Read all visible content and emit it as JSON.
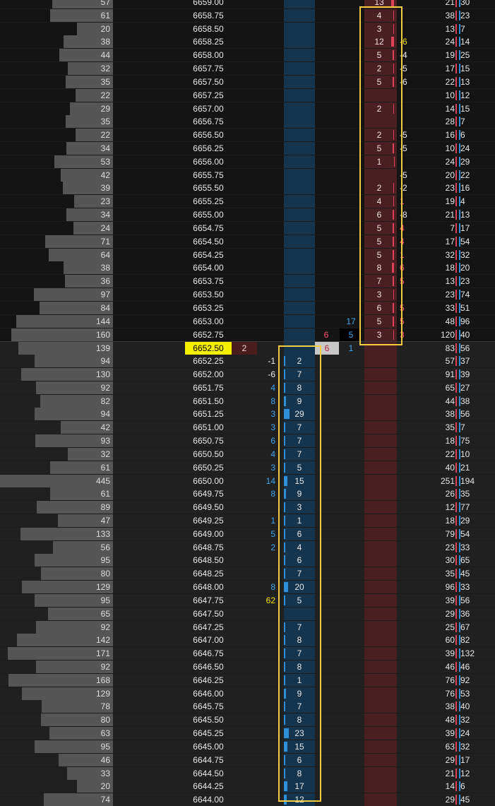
{
  "app_title": "",
  "last_price": "6652.50",
  "last_trade_size": "2",
  "colors": {
    "ask_bg": "#4a1f22",
    "bid_bg": "#15354e",
    "highlight": "#f3cc3f",
    "last_price_bg": "#f4ee00"
  },
  "ask_rows": [
    {
      "price": "6659.00",
      "volume": "57",
      "ask": "13",
      "ask_chg": "",
      "col1": "21",
      "col2": "30"
    },
    {
      "price": "6658.75",
      "volume": "61",
      "ask": "4",
      "ask_chg": "",
      "col1": "38",
      "col2": "23"
    },
    {
      "price": "6658.50",
      "volume": "20",
      "ask": "3",
      "ask_chg": "",
      "col1": "13",
      "col2": "7"
    },
    {
      "price": "6658.25",
      "volume": "38",
      "ask": "12",
      "ask_chg": "-6",
      "col1": "24",
      "col2": "14"
    },
    {
      "price": "6658.00",
      "volume": "44",
      "ask": "5",
      "ask_chg": "-4",
      "col1": "19",
      "col2": "25"
    },
    {
      "price": "6657.75",
      "volume": "32",
      "ask": "2",
      "ask_chg": "-5",
      "col1": "17",
      "col2": "15"
    },
    {
      "price": "6657.50",
      "volume": "35",
      "ask": "5",
      "ask_chg": "-6",
      "col1": "22",
      "col2": "13"
    },
    {
      "price": "6657.25",
      "volume": "22",
      "ask": "",
      "ask_chg": "",
      "col1": "10",
      "col2": "12"
    },
    {
      "price": "6657.00",
      "volume": "29",
      "ask": "2",
      "ask_chg": "",
      "col1": "14",
      "col2": "15"
    },
    {
      "price": "6656.75",
      "volume": "35",
      "ask": "",
      "ask_chg": "",
      "col1": "28",
      "col2": "7"
    },
    {
      "price": "6656.50",
      "volume": "22",
      "ask": "2",
      "ask_chg": "-5",
      "col1": "16",
      "col2": "6"
    },
    {
      "price": "6656.25",
      "volume": "34",
      "ask": "5",
      "ask_chg": "-5",
      "col1": "10",
      "col2": "24"
    },
    {
      "price": "6656.00",
      "volume": "53",
      "ask": "1",
      "ask_chg": "",
      "col1": "24",
      "col2": "29"
    },
    {
      "price": "6655.75",
      "volume": "42",
      "ask": "",
      "ask_chg": "-5",
      "col1": "20",
      "col2": "22"
    },
    {
      "price": "6655.50",
      "volume": "39",
      "ask": "2",
      "ask_chg": "-2",
      "col1": "23",
      "col2": "16"
    },
    {
      "price": "6655.25",
      "volume": "23",
      "ask": "4",
      "ask_chg": "1",
      "col1": "19",
      "col2": "4"
    },
    {
      "price": "6655.00",
      "volume": "34",
      "ask": "6",
      "ask_chg": "-8",
      "col1": "21",
      "col2": "13"
    },
    {
      "price": "6654.75",
      "volume": "24",
      "ask": "5",
      "ask_chg": "4",
      "col1": "7",
      "col2": "17"
    },
    {
      "price": "6654.50",
      "volume": "71",
      "ask": "5",
      "ask_chg": "4",
      "col1": "17",
      "col2": "54"
    },
    {
      "price": "6654.25",
      "volume": "64",
      "ask": "5",
      "ask_chg": "1",
      "col1": "32",
      "col2": "32"
    },
    {
      "price": "6654.00",
      "volume": "38",
      "ask": "8",
      "ask_chg": "6",
      "col1": "18",
      "col2": "20"
    },
    {
      "price": "6653.75",
      "volume": "36",
      "ask": "7",
      "ask_chg": "5",
      "col1": "13",
      "col2": "23"
    },
    {
      "price": "6653.50",
      "volume": "97",
      "ask": "3",
      "ask_chg": "",
      "col1": "23",
      "col2": "74"
    },
    {
      "price": "6653.25",
      "volume": "84",
      "ask": "6",
      "ask_chg": "5",
      "col1": "33",
      "col2": "51"
    },
    {
      "price": "6653.00",
      "volume": "144",
      "ask": "5",
      "ask_chg": "5",
      "col1": "48",
      "col2": "96"
    },
    {
      "price": "6652.75",
      "volume": "160",
      "ask": "3",
      "ask_chg": "3",
      "col1": "120",
      "col2": "40"
    }
  ],
  "row_6653_pulls": {
    "left": "17",
    "right": ""
  },
  "row_665275_pulls": {
    "a": "6",
    "b": "5"
  },
  "last_row": {
    "price": "6652.50",
    "volume": "139",
    "box": "6",
    "pull": "1",
    "col1": "83",
    "col2": "56"
  },
  "bid_rows": [
    {
      "price": "6652.25",
      "volume": "94",
      "bid_chg": "-1",
      "bid": "2",
      "col1": "57",
      "col2": "37"
    },
    {
      "price": "6652.00",
      "volume": "130",
      "bid_chg": "-6",
      "bid": "7",
      "col1": "91",
      "col2": "39"
    },
    {
      "price": "6651.75",
      "volume": "92",
      "bid_chg": "4",
      "bid": "8",
      "col1": "65",
      "col2": "27"
    },
    {
      "price": "6651.50",
      "volume": "82",
      "bid_chg": "8",
      "bid": "9",
      "col1": "44",
      "col2": "38"
    },
    {
      "price": "6651.25",
      "volume": "94",
      "bid_chg": "3",
      "bid": "29",
      "col1": "38",
      "col2": "56"
    },
    {
      "price": "6651.00",
      "volume": "42",
      "bid_chg": "3",
      "bid": "7",
      "col1": "35",
      "col2": "7"
    },
    {
      "price": "6650.75",
      "volume": "93",
      "bid_chg": "6",
      "bid": "7",
      "col1": "18",
      "col2": "75"
    },
    {
      "price": "6650.50",
      "volume": "32",
      "bid_chg": "4",
      "bid": "7",
      "col1": "22",
      "col2": "10"
    },
    {
      "price": "6650.25",
      "volume": "61",
      "bid_chg": "3",
      "bid": "5",
      "col1": "40",
      "col2": "21"
    },
    {
      "price": "6650.00",
      "volume": "445",
      "bid_chg": "14",
      "bid": "15",
      "col1": "251",
      "col2": "194"
    },
    {
      "price": "6649.75",
      "volume": "61",
      "bid_chg": "8",
      "bid": "9",
      "col1": "26",
      "col2": "35"
    },
    {
      "price": "6649.50",
      "volume": "89",
      "bid_chg": "",
      "bid": "3",
      "col1": "12",
      "col2": "77"
    },
    {
      "price": "6649.25",
      "volume": "47",
      "bid_chg": "1",
      "bid": "1",
      "col1": "18",
      "col2": "29"
    },
    {
      "price": "6649.00",
      "volume": "133",
      "bid_chg": "5",
      "bid": "6",
      "col1": "79",
      "col2": "54"
    },
    {
      "price": "6648.75",
      "volume": "56",
      "bid_chg": "2",
      "bid": "4",
      "col1": "23",
      "col2": "33"
    },
    {
      "price": "6648.50",
      "volume": "95",
      "bid_chg": "",
      "bid": "6",
      "col1": "30",
      "col2": "65"
    },
    {
      "price": "6648.25",
      "volume": "80",
      "bid_chg": "",
      "bid": "7",
      "col1": "35",
      "col2": "45"
    },
    {
      "price": "6648.00",
      "volume": "129",
      "bid_chg": "8",
      "bid": "20",
      "col1": "96",
      "col2": "33"
    },
    {
      "price": "6647.75",
      "volume": "95",
      "bid_chg": "62",
      "bid": "5",
      "col1": "39",
      "col2": "56"
    },
    {
      "price": "6647.50",
      "volume": "65",
      "bid_chg": "",
      "bid": "",
      "col1": "29",
      "col2": "36"
    },
    {
      "price": "6647.25",
      "volume": "92",
      "bid_chg": "",
      "bid": "7",
      "col1": "25",
      "col2": "67"
    },
    {
      "price": "6647.00",
      "volume": "142",
      "bid_chg": "",
      "bid": "8",
      "col1": "60",
      "col2": "82"
    },
    {
      "price": "6646.75",
      "volume": "171",
      "bid_chg": "",
      "bid": "7",
      "col1": "39",
      "col2": "132"
    },
    {
      "price": "6646.50",
      "volume": "92",
      "bid_chg": "",
      "bid": "8",
      "col1": "46",
      "col2": "46"
    },
    {
      "price": "6646.25",
      "volume": "168",
      "bid_chg": "",
      "bid": "1",
      "col1": "76",
      "col2": "92"
    },
    {
      "price": "6646.00",
      "volume": "129",
      "bid_chg": "",
      "bid": "9",
      "col1": "76",
      "col2": "53"
    },
    {
      "price": "6645.75",
      "volume": "78",
      "bid_chg": "",
      "bid": "7",
      "col1": "38",
      "col2": "40"
    },
    {
      "price": "6645.50",
      "volume": "80",
      "bid_chg": "",
      "bid": "8",
      "col1": "48",
      "col2": "32"
    },
    {
      "price": "6645.25",
      "volume": "63",
      "bid_chg": "",
      "bid": "23",
      "col1": "39",
      "col2": "24"
    },
    {
      "price": "6645.00",
      "volume": "95",
      "bid_chg": "",
      "bid": "15",
      "col1": "63",
      "col2": "32"
    },
    {
      "price": "6644.75",
      "volume": "46",
      "bid_chg": "",
      "bid": "6",
      "col1": "29",
      "col2": "17"
    },
    {
      "price": "6644.50",
      "volume": "33",
      "bid_chg": "",
      "bid": "8",
      "col1": "21",
      "col2": "12"
    },
    {
      "price": "6644.25",
      "volume": "20",
      "bid_chg": "",
      "bid": "17",
      "col1": "14",
      "col2": "6"
    },
    {
      "price": "6644.00",
      "volume": "74",
      "bid_chg": "",
      "bid": "12",
      "col1": "29",
      "col2": "45"
    }
  ]
}
